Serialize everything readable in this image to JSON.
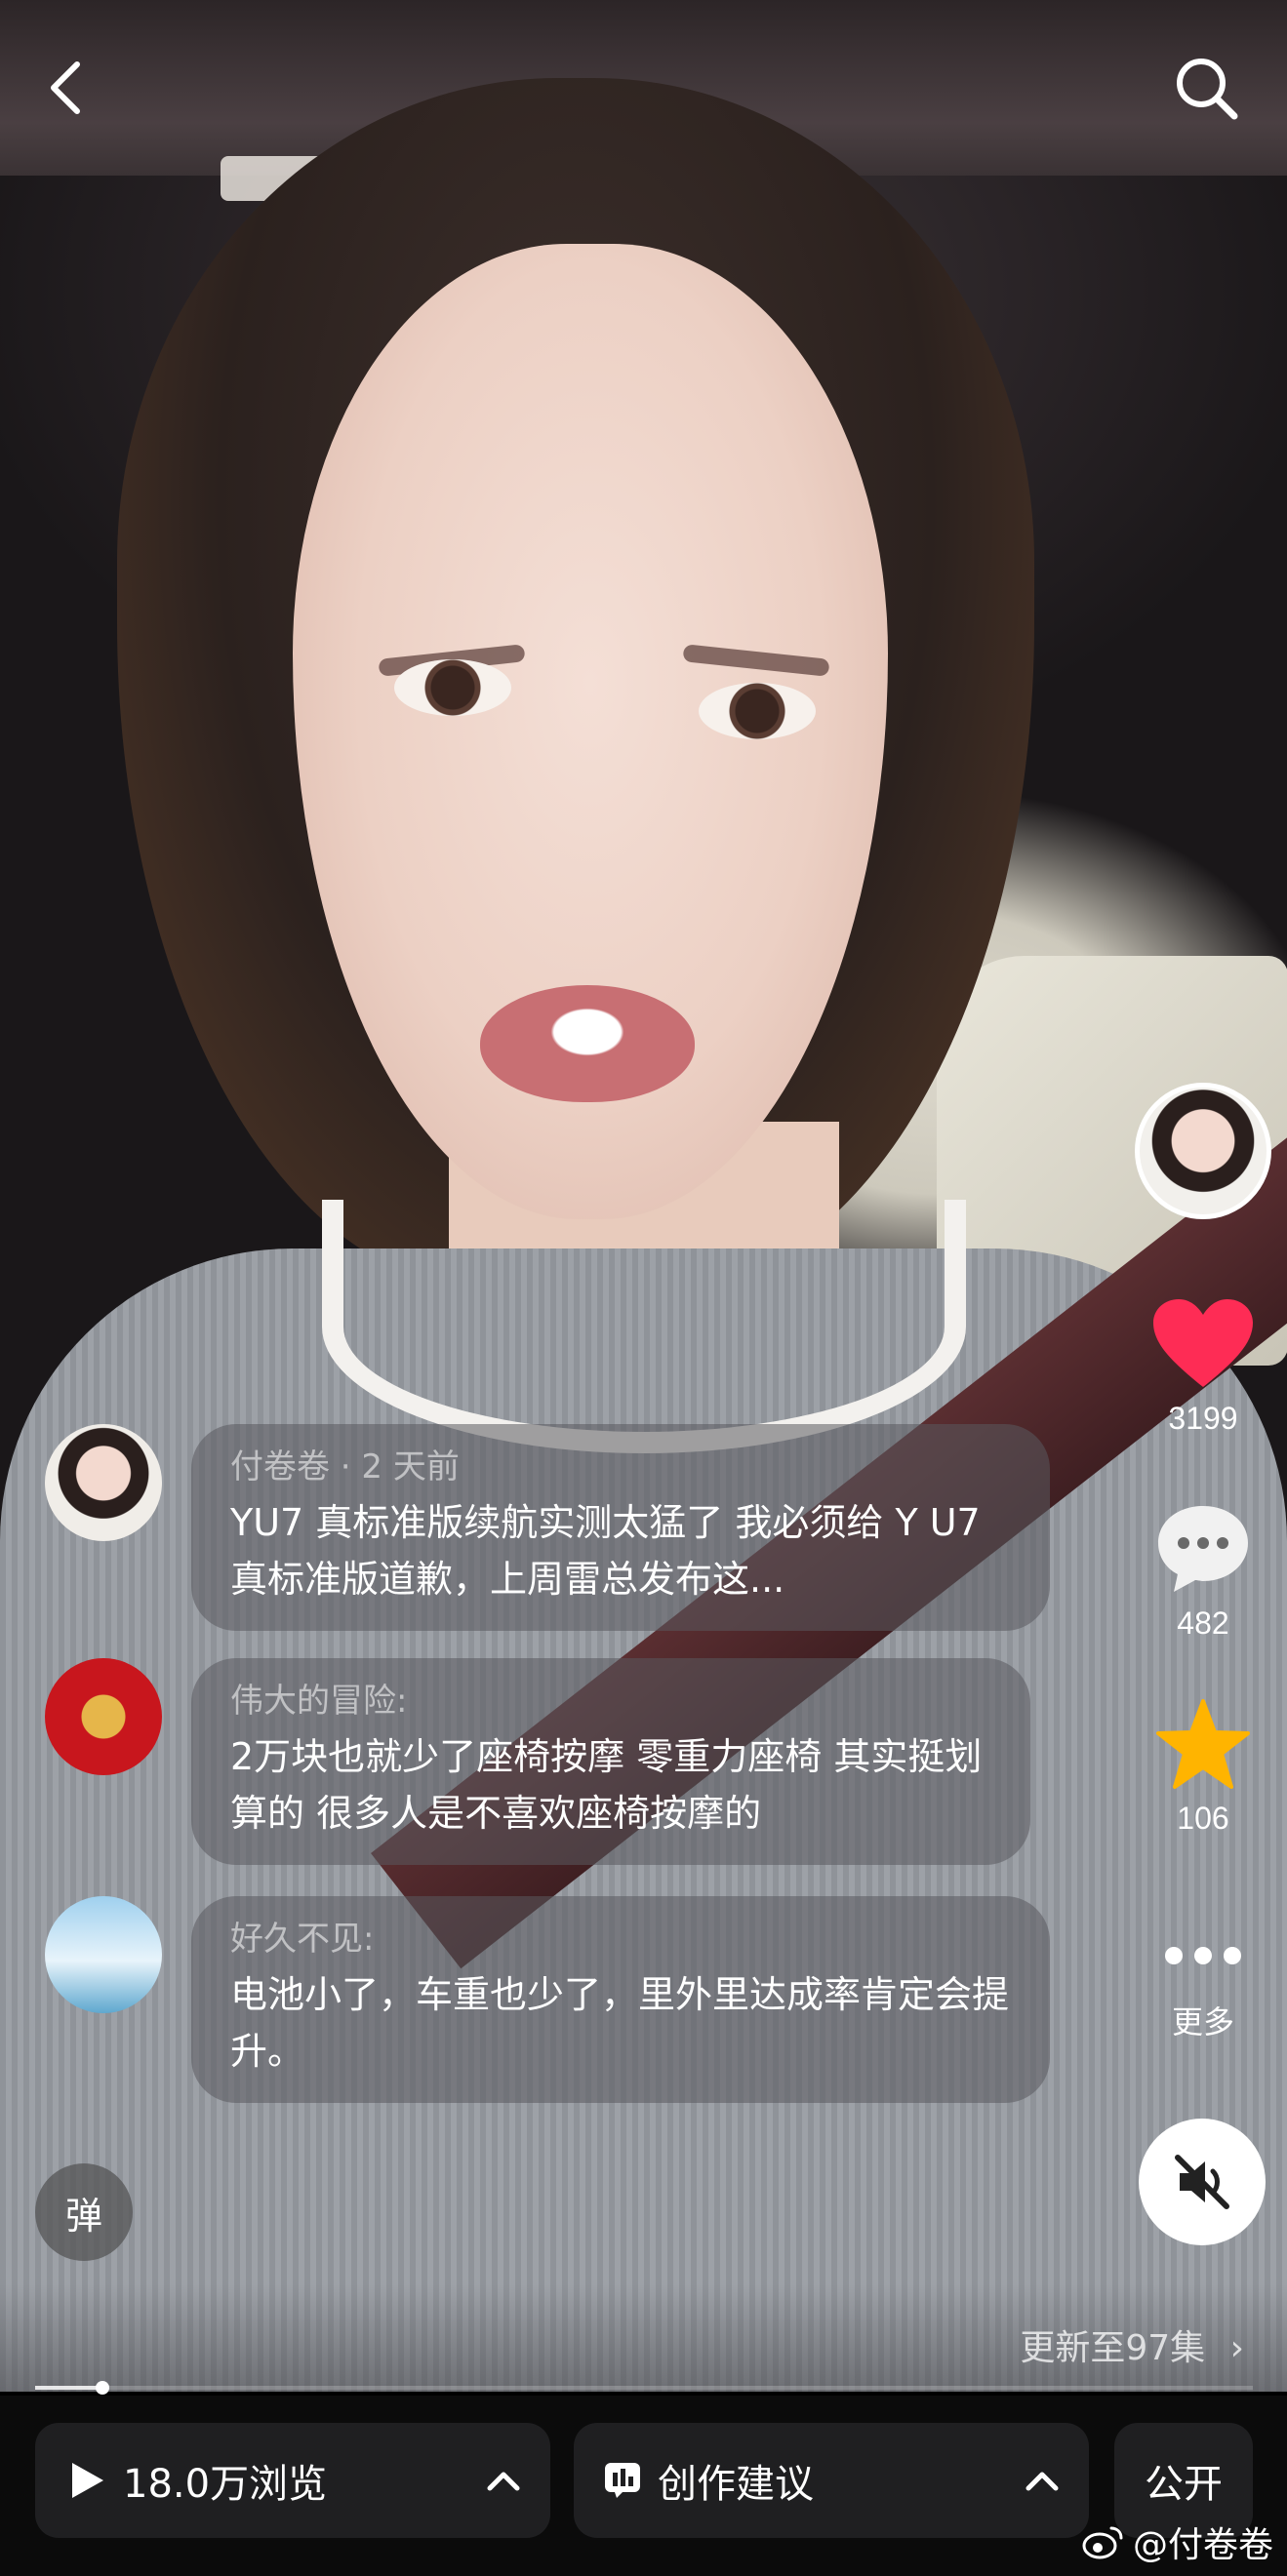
{
  "top_bar": {
    "back_icon": "chevron-left-icon",
    "search_icon": "search-icon"
  },
  "rail": {
    "likes": "3199",
    "comments": "482",
    "favorites": "106",
    "more_label": "更多",
    "colors": {
      "like": "#fe2c55",
      "favorite": "#ffb400"
    }
  },
  "comments": [
    {
      "name": "付卷卷 · 2 天前",
      "text": "YU7 真标准版续航实测太猛了 我必须给 Y U7 真标准版道歉，上周雷总发布这..."
    },
    {
      "name": "伟大的冒险:",
      "text": "2万块也就少了座椅按摩 零重力座椅 其实挺划算的 很多人是不喜欢座椅按摩的"
    },
    {
      "name": "好久不见:",
      "text": "电池小了，车重也少了，里外里达成率肯定会提升。"
    }
  ],
  "danmu_label": "弹",
  "episode": {
    "text": "更新至97集",
    "progress": 0.055
  },
  "bottom": {
    "views": "18.0万浏览",
    "suggestion": "创作建议",
    "publish": "公开"
  },
  "watermark": "@付卷卷"
}
